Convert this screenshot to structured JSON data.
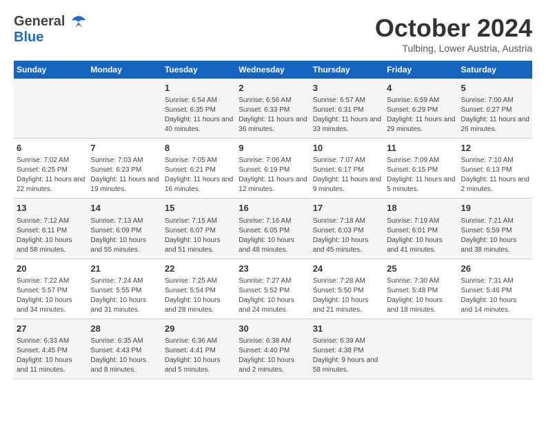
{
  "header": {
    "logo_general": "General",
    "logo_blue": "Blue",
    "month_title": "October 2024",
    "location": "Tulbing, Lower Austria, Austria"
  },
  "days_of_week": [
    "Sunday",
    "Monday",
    "Tuesday",
    "Wednesday",
    "Thursday",
    "Friday",
    "Saturday"
  ],
  "weeks": [
    [
      {
        "day": "",
        "info": ""
      },
      {
        "day": "",
        "info": ""
      },
      {
        "day": "1",
        "info": "Sunrise: 6:54 AM\nSunset: 6:35 PM\nDaylight: 11 hours and 40 minutes."
      },
      {
        "day": "2",
        "info": "Sunrise: 6:56 AM\nSunset: 6:33 PM\nDaylight: 11 hours and 36 minutes."
      },
      {
        "day": "3",
        "info": "Sunrise: 6:57 AM\nSunset: 6:31 PM\nDaylight: 11 hours and 33 minutes."
      },
      {
        "day": "4",
        "info": "Sunrise: 6:59 AM\nSunset: 6:29 PM\nDaylight: 11 hours and 29 minutes."
      },
      {
        "day": "5",
        "info": "Sunrise: 7:00 AM\nSunset: 6:27 PM\nDaylight: 11 hours and 26 minutes."
      }
    ],
    [
      {
        "day": "6",
        "info": "Sunrise: 7:02 AM\nSunset: 6:25 PM\nDaylight: 11 hours and 22 minutes."
      },
      {
        "day": "7",
        "info": "Sunrise: 7:03 AM\nSunset: 6:23 PM\nDaylight: 11 hours and 19 minutes."
      },
      {
        "day": "8",
        "info": "Sunrise: 7:05 AM\nSunset: 6:21 PM\nDaylight: 11 hours and 16 minutes."
      },
      {
        "day": "9",
        "info": "Sunrise: 7:06 AM\nSunset: 6:19 PM\nDaylight: 11 hours and 12 minutes."
      },
      {
        "day": "10",
        "info": "Sunrise: 7:07 AM\nSunset: 6:17 PM\nDaylight: 11 hours and 9 minutes."
      },
      {
        "day": "11",
        "info": "Sunrise: 7:09 AM\nSunset: 6:15 PM\nDaylight: 11 hours and 5 minutes."
      },
      {
        "day": "12",
        "info": "Sunrise: 7:10 AM\nSunset: 6:13 PM\nDaylight: 11 hours and 2 minutes."
      }
    ],
    [
      {
        "day": "13",
        "info": "Sunrise: 7:12 AM\nSunset: 6:11 PM\nDaylight: 10 hours and 58 minutes."
      },
      {
        "day": "14",
        "info": "Sunrise: 7:13 AM\nSunset: 6:09 PM\nDaylight: 10 hours and 55 minutes."
      },
      {
        "day": "15",
        "info": "Sunrise: 7:15 AM\nSunset: 6:07 PM\nDaylight: 10 hours and 51 minutes."
      },
      {
        "day": "16",
        "info": "Sunrise: 7:16 AM\nSunset: 6:05 PM\nDaylight: 10 hours and 48 minutes."
      },
      {
        "day": "17",
        "info": "Sunrise: 7:18 AM\nSunset: 6:03 PM\nDaylight: 10 hours and 45 minutes."
      },
      {
        "day": "18",
        "info": "Sunrise: 7:19 AM\nSunset: 6:01 PM\nDaylight: 10 hours and 41 minutes."
      },
      {
        "day": "19",
        "info": "Sunrise: 7:21 AM\nSunset: 5:59 PM\nDaylight: 10 hours and 38 minutes."
      }
    ],
    [
      {
        "day": "20",
        "info": "Sunrise: 7:22 AM\nSunset: 5:57 PM\nDaylight: 10 hours and 34 minutes."
      },
      {
        "day": "21",
        "info": "Sunrise: 7:24 AM\nSunset: 5:55 PM\nDaylight: 10 hours and 31 minutes."
      },
      {
        "day": "22",
        "info": "Sunrise: 7:25 AM\nSunset: 5:54 PM\nDaylight: 10 hours and 28 minutes."
      },
      {
        "day": "23",
        "info": "Sunrise: 7:27 AM\nSunset: 5:52 PM\nDaylight: 10 hours and 24 minutes."
      },
      {
        "day": "24",
        "info": "Sunrise: 7:28 AM\nSunset: 5:50 PM\nDaylight: 10 hours and 21 minutes."
      },
      {
        "day": "25",
        "info": "Sunrise: 7:30 AM\nSunset: 5:48 PM\nDaylight: 10 hours and 18 minutes."
      },
      {
        "day": "26",
        "info": "Sunrise: 7:31 AM\nSunset: 5:46 PM\nDaylight: 10 hours and 14 minutes."
      }
    ],
    [
      {
        "day": "27",
        "info": "Sunrise: 6:33 AM\nSunset: 4:45 PM\nDaylight: 10 hours and 11 minutes."
      },
      {
        "day": "28",
        "info": "Sunrise: 6:35 AM\nSunset: 4:43 PM\nDaylight: 10 hours and 8 minutes."
      },
      {
        "day": "29",
        "info": "Sunrise: 6:36 AM\nSunset: 4:41 PM\nDaylight: 10 hours and 5 minutes."
      },
      {
        "day": "30",
        "info": "Sunrise: 6:38 AM\nSunset: 4:40 PM\nDaylight: 10 hours and 2 minutes."
      },
      {
        "day": "31",
        "info": "Sunrise: 6:39 AM\nSunset: 4:38 PM\nDaylight: 9 hours and 58 minutes."
      },
      {
        "day": "",
        "info": ""
      },
      {
        "day": "",
        "info": ""
      }
    ]
  ]
}
